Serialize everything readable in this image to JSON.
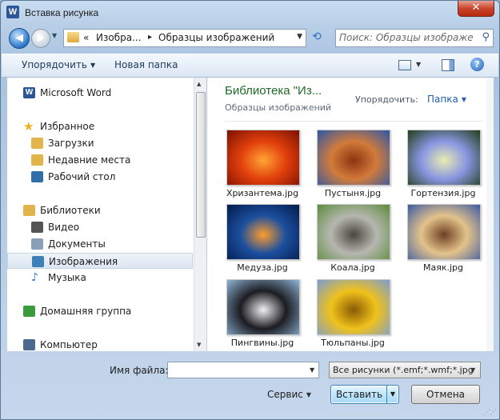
{
  "window": {
    "title": "Вставка рисунка",
    "app_icon_letter": "W",
    "close_glyph": "✕"
  },
  "navbar": {
    "back_glyph": "◀",
    "forward_glyph": "▶",
    "breadcrumb_overflow": "«",
    "breadcrumb": [
      "Изобра...",
      "Образцы изображений"
    ],
    "breadcrumb_separator": "▸",
    "search_placeholder": "Поиск: Образцы изображений"
  },
  "toolbar": {
    "organize_label": "Упорядочить",
    "new_folder_label": "Новая папка",
    "help_glyph": "?"
  },
  "sidebar": {
    "items": [
      {
        "label": "Microsoft Word",
        "icon": "word-icon",
        "color": "#2b5797"
      },
      {
        "label": "Избранное",
        "icon": "star-icon",
        "color": "#f2b01e"
      },
      {
        "label": "Загрузки",
        "icon": "downloads-folder-icon",
        "color": "#e3b44c"
      },
      {
        "label": "Недавние места",
        "icon": "recent-places-icon",
        "color": "#e3b44c"
      },
      {
        "label": "Рабочий стол",
        "icon": "desktop-icon",
        "color": "#2f6fa8"
      },
      {
        "label": "Библиотеки",
        "icon": "libraries-icon",
        "color": "#e3b44c"
      },
      {
        "label": "Видео",
        "icon": "video-icon",
        "color": "#555555"
      },
      {
        "label": "Документы",
        "icon": "documents-icon",
        "color": "#8aa0b8"
      },
      {
        "label": "Изображения",
        "icon": "pictures-icon",
        "color": "#3d7fb8"
      },
      {
        "label": "Музыка",
        "icon": "music-icon",
        "color": "#2d79c7"
      },
      {
        "label": "Домашняя группа",
        "icon": "homegroup-icon",
        "color": "#3b9a3b"
      },
      {
        "label": "Компьютер",
        "icon": "computer-icon",
        "color": "#4a6b8e"
      }
    ],
    "selected_index": 8
  },
  "content": {
    "library_title": "Библиотека \"Из...",
    "library_subtitle": "Образцы изображений",
    "arrange_label": "Упорядочить:",
    "arrange_value": "Папка",
    "files": [
      {
        "name": "Хризантема.jpg",
        "colors": [
          "#7a1003",
          "#e2400c",
          "#ffa434"
        ]
      },
      {
        "name": "Пустыня.jpg",
        "colors": [
          "#2a57a8",
          "#d27b3b",
          "#8e3410"
        ]
      },
      {
        "name": "Гортензия.jpg",
        "colors": [
          "#1f3d17",
          "#8a96e2",
          "#e8ecb0"
        ]
      },
      {
        "name": "Медуза.jpg",
        "colors": [
          "#041a4a",
          "#1b4f9e",
          "#ff9b2d"
        ]
      },
      {
        "name": "Коала.jpg",
        "colors": [
          "#5b8c3a",
          "#b6b7b0",
          "#4a4640"
        ]
      },
      {
        "name": "Маяк.jpg",
        "colors": [
          "#3b5aa3",
          "#e3c38a",
          "#6e3f24"
        ]
      },
      {
        "name": "Пингвины.jpg",
        "colors": [
          "#8fb6d8",
          "#1c1c22",
          "#f1f1f3"
        ]
      },
      {
        "name": "Тюльпаны.jpg",
        "colors": [
          "#7a9cd6",
          "#f0c21a",
          "#8a5a06"
        ]
      }
    ]
  },
  "footer": {
    "filename_label": "Имя файла:",
    "filename_value": "",
    "filter_value": "Все рисунки (*.emf;*.wmf;*.jpg",
    "service_label": "Сервис",
    "insert_label": "Вставить",
    "cancel_label": "Отмена"
  }
}
